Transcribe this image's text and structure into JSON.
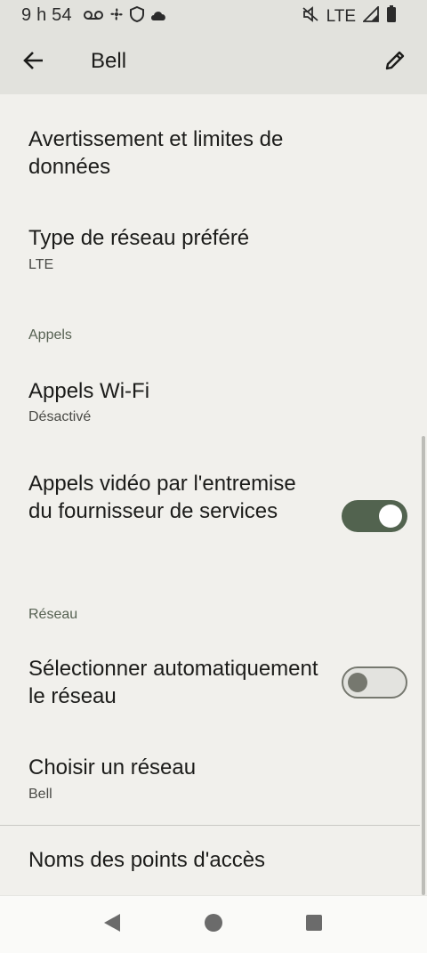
{
  "status_bar": {
    "time": "9 h 54",
    "network": "LTE",
    "icons": [
      "voicemail-icon",
      "fan-icon",
      "shield-icon",
      "cloud-icon",
      "mute-icon",
      "signal-icon",
      "battery-icon"
    ]
  },
  "app_bar": {
    "title": "Bell",
    "back_icon": "arrow-left-icon",
    "edit_icon": "pencil-icon"
  },
  "settings": {
    "data_warning": {
      "title": "Avertissement et limites de données"
    },
    "preferred_network": {
      "title": "Type de réseau préféré",
      "summary": "LTE"
    },
    "calls_header": "Appels",
    "wifi_calling": {
      "title": "Appels Wi-Fi",
      "summary": "Désactivé"
    },
    "video_calling": {
      "title": "Appels vidéo par l'entremise du fournisseur de services",
      "enabled": true
    },
    "network_header": "Réseau",
    "auto_select": {
      "title": "Sélectionner automatiquement le réseau",
      "enabled": false
    },
    "choose_network": {
      "title": "Choisir un réseau",
      "summary": "Bell"
    },
    "apn": {
      "title": "Noms des points d'accès"
    }
  },
  "nav_bar": {
    "back": "nav-back-icon",
    "home": "nav-home-icon",
    "recents": "nav-recents-icon"
  },
  "colors": {
    "background": "#f1f0ec",
    "app_bar": "#e2e2dd",
    "toggle_on": "#52634f",
    "section_header": "#566152"
  }
}
